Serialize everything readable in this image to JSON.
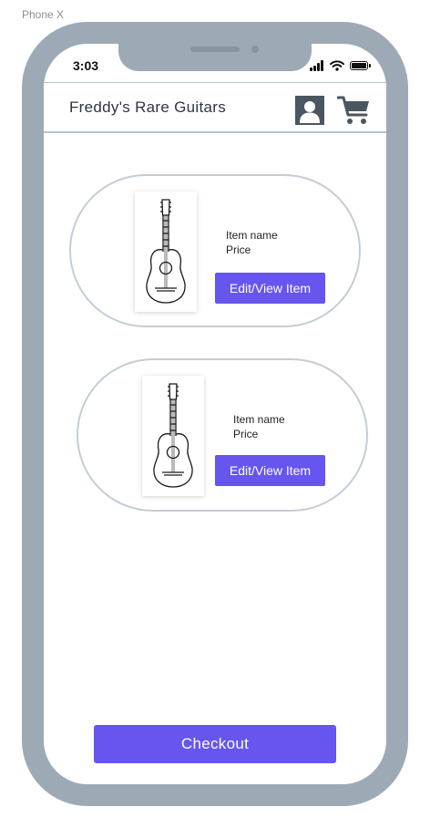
{
  "device": {
    "label": "Phone X"
  },
  "status_bar": {
    "time": "3:03",
    "icons": [
      "signal-icon",
      "wifi-icon",
      "battery-icon"
    ]
  },
  "header": {
    "title": "Freddy's Rare Guitars",
    "icons": [
      "user-icon",
      "cart-icon"
    ]
  },
  "items": [
    {
      "name": "Item name",
      "price": "Price",
      "button_label": "Edit/View Item",
      "image_icon": "guitar-icon"
    },
    {
      "name": "Item name",
      "price": "Price",
      "button_label": "Edit/View Item",
      "image_icon": "guitar-icon"
    }
  ],
  "checkout": {
    "label": "Checkout"
  },
  "colors": {
    "frame": "#9daab6",
    "accent": "#6655ee",
    "divider": "#b8c3cd",
    "icon": "#4a5661"
  }
}
